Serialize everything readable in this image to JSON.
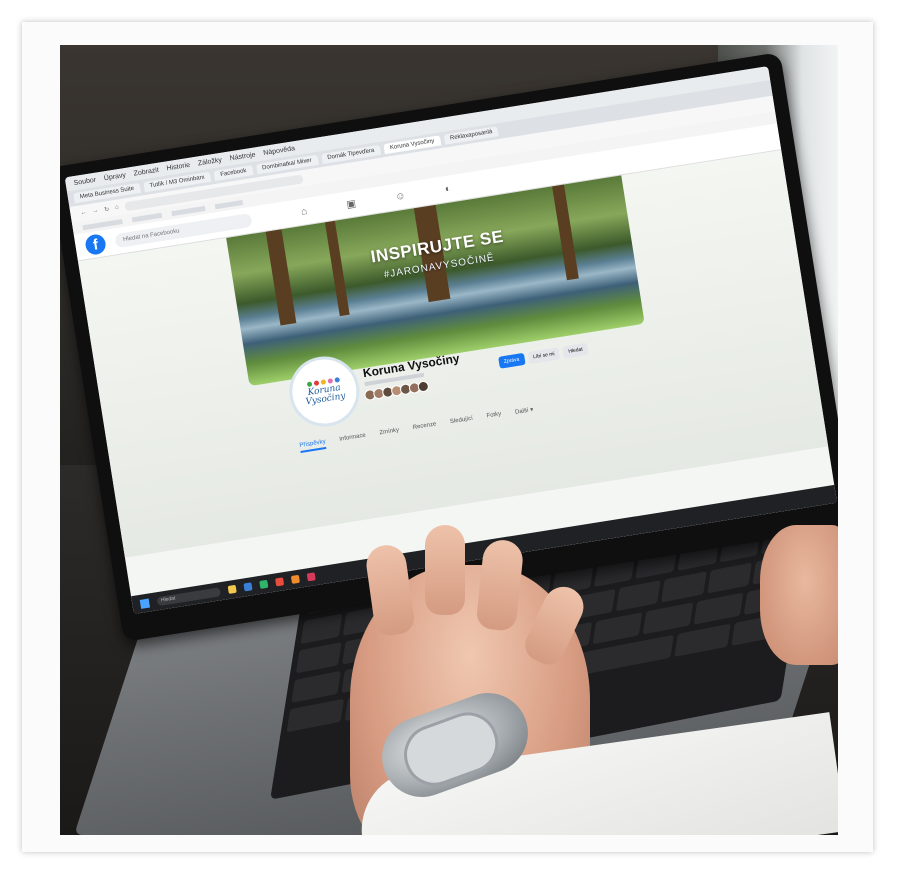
{
  "browser": {
    "menu_items": [
      "Soubor",
      "Úpravy",
      "Zobrazit",
      "Historie",
      "Záložky",
      "Nástroje",
      "Nápověda"
    ],
    "tabs": [
      "Meta Business Suite",
      "Tutlík / M3 Ominbarx",
      "Facebook",
      "Dombinatkaí Mixer",
      "Domák Tipevďera",
      "Koruna Vysočiny",
      "Reklaxaposanlá"
    ]
  },
  "facebook": {
    "search_placeholder": "Hledat na Facebooku"
  },
  "cover": {
    "headline": "INSPIRUJTE SE",
    "hashtag": "#JARONAVYSOČINĚ"
  },
  "page": {
    "name": "Koruna Vysočiny",
    "logo_line1": "Koruna",
    "logo_line2": "Vysočiny",
    "actions": [
      "Zpráva",
      "Líbí se mi",
      "Hledat"
    ],
    "tabs": [
      "Příspěvky",
      "Informace",
      "Zmínky",
      "Recenze",
      "Sledující",
      "Fotky",
      "Další ▾"
    ]
  },
  "taskbar": {
    "search_label": "Hledat"
  },
  "colors": {
    "facebook_blue": "#1877f2",
    "logo_blue": "#1f5d9c"
  }
}
